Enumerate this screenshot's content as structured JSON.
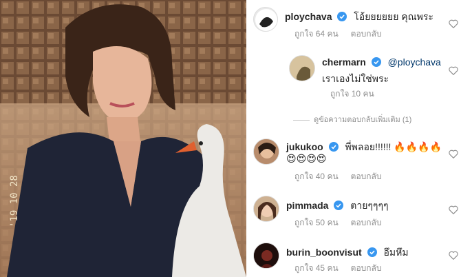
{
  "comments": [
    {
      "username": "ploychava",
      "text": "โอ้ยยยยยย คุณพระ",
      "likes": "ถูกใจ 64 คน",
      "reply": "ตอบกลับ"
    },
    {
      "username": "chermarn",
      "mention": "@ploychava",
      "text": "เราเองไม่ใช่พระ",
      "likes": "ถูกใจ 10 คน"
    },
    {
      "username": "jukukoo",
      "text": "พี่พลอย!!!!!!",
      "emoji_line1": "🔥🔥🔥🔥",
      "emoji_line2": "😍😍😍😍",
      "likes": "ถูกใจ 40 คน",
      "reply": "ตอบกลับ"
    },
    {
      "username": "pimmada",
      "text": "ตายๆๆๆๆ",
      "likes": "ถูกใจ 50 คน",
      "reply": "ตอบกลับ"
    },
    {
      "username": "burin_boonvisut",
      "text": "อึมหึม",
      "likes": "ถูกใจ 45 คน",
      "reply": "ตอบกลับ"
    }
  ],
  "view_replies": "ดูข้อความตอบกลับเพิ่มเติม (1)",
  "colors": {
    "verified": "#3897f0",
    "heart": "#8e8e8e",
    "text": "#262626",
    "meta": "#8e8e8e"
  }
}
